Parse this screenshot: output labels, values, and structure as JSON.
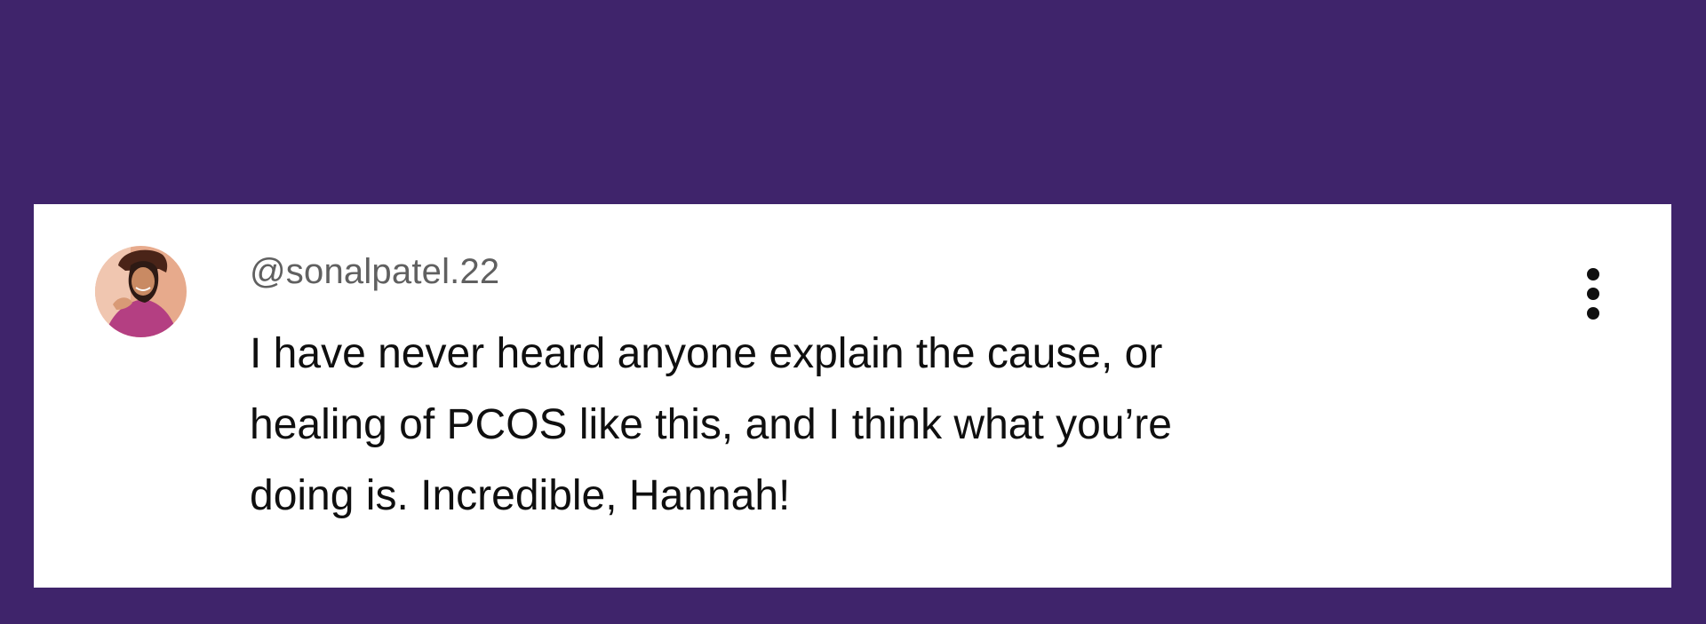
{
  "comment": {
    "username": "@sonalpatel.22",
    "text_lines": [
      "I have never heard anyone explain the cause, or",
      "healing of PCOS like this, and I think what you’re",
      "doing is. Incredible, Hannah!"
    ],
    "avatar_icon": "user-avatar-photo",
    "menu_icon": "vertical-ellipsis-icon"
  },
  "colors": {
    "background": "#3f246b",
    "card": "#ffffff",
    "username": "#606060",
    "text": "#0f0f0f"
  }
}
